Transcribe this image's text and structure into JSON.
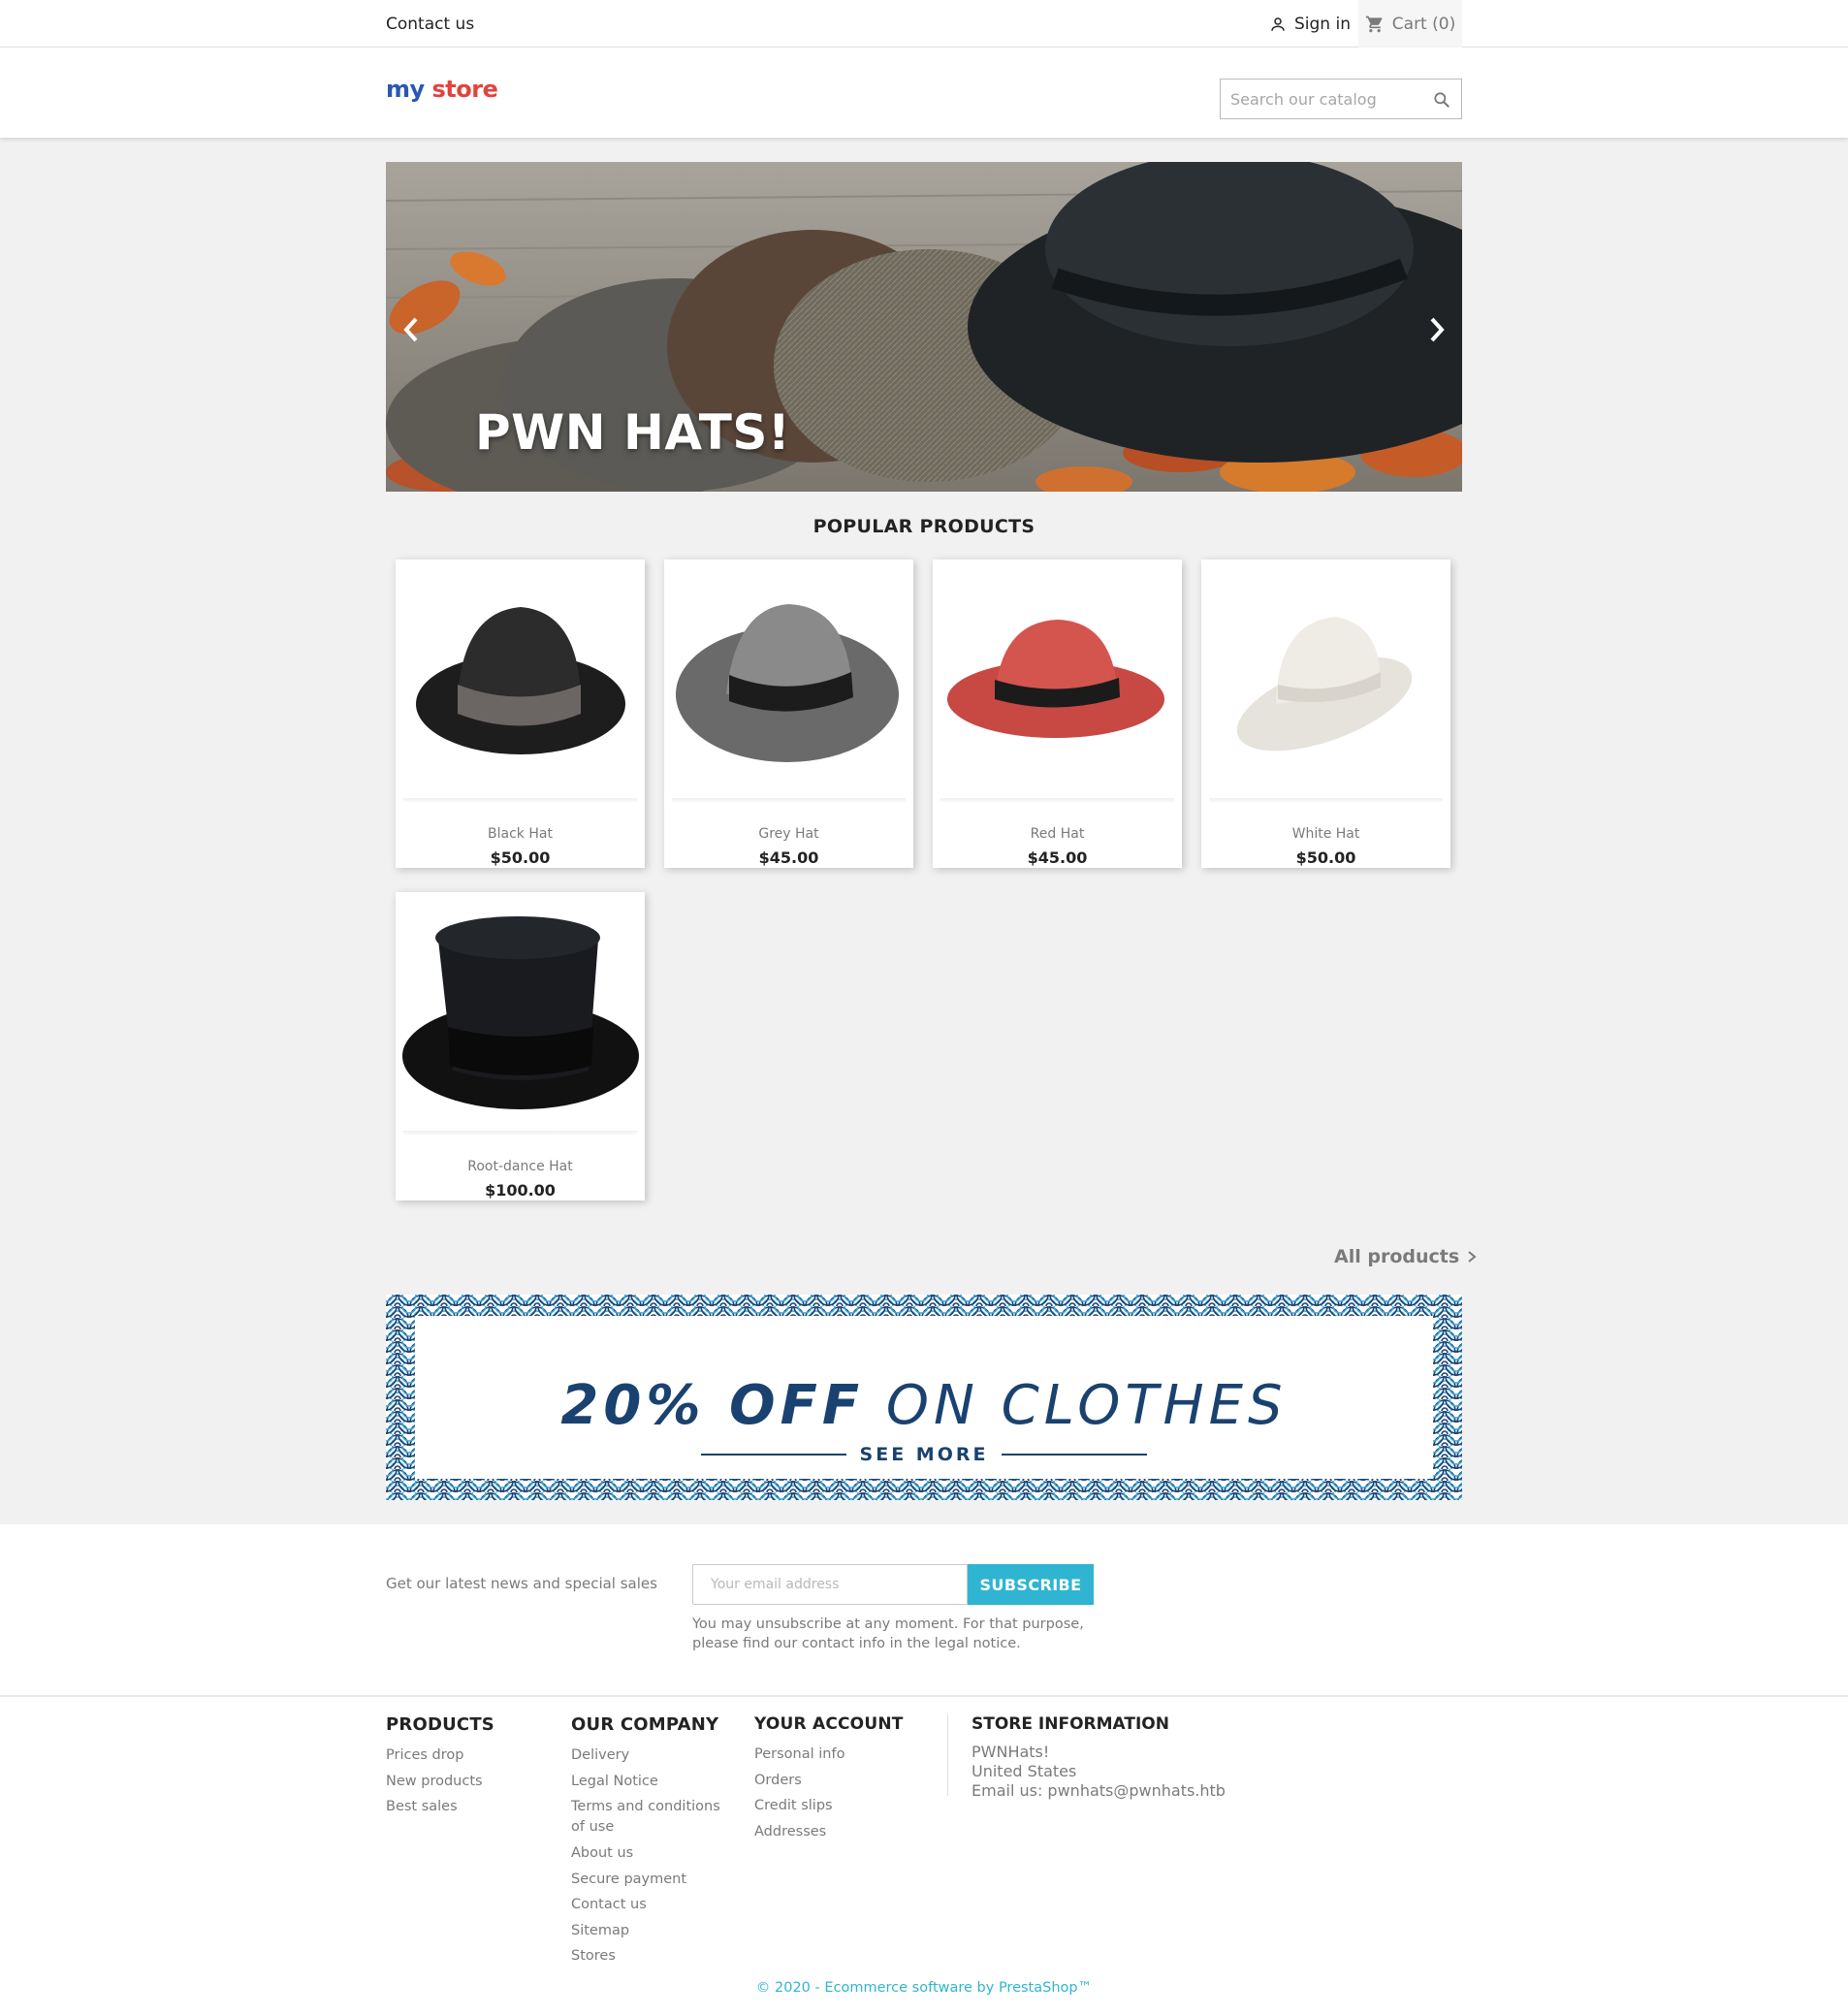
{
  "nav": {
    "contact": "Contact us",
    "signin": "Sign in",
    "cart": "Cart (0)"
  },
  "header": {
    "logo_word1": "my",
    "logo_word2": "store",
    "search_placeholder": "Search our catalog"
  },
  "hero": {
    "caption": "PWN HATS!"
  },
  "popular": {
    "title": "POPULAR PRODUCTS",
    "products": [
      {
        "name": "Black Hat",
        "price": "$50.00"
      },
      {
        "name": "Grey Hat",
        "price": "$45.00"
      },
      {
        "name": "Red Hat",
        "price": "$45.00"
      },
      {
        "name": "White Hat",
        "price": "$50.00"
      },
      {
        "name": "Root-dance Hat",
        "price": "$100.00"
      }
    ],
    "all_products": "All products"
  },
  "banner": {
    "bold": "20% OFF",
    "rest": "ON CLOTHES",
    "cta": "SEE MORE"
  },
  "newsletter": {
    "text": "Get our latest news and special sales",
    "placeholder": "Your email address",
    "button": "SUBSCRIBE",
    "note": "You may unsubscribe at any moment. For that purpose, please find our contact info in the legal notice."
  },
  "footer": {
    "products": {
      "title": "PRODUCTS",
      "links": [
        "Prices drop",
        "New products",
        "Best sales"
      ]
    },
    "company": {
      "title": "OUR COMPANY",
      "links": [
        "Delivery",
        "Legal Notice",
        "Terms and conditions of use",
        "About us",
        "Secure payment",
        "Contact us",
        "Sitemap",
        "Stores"
      ]
    },
    "account": {
      "title": "YOUR ACCOUNT",
      "links": [
        "Personal info",
        "Orders",
        "Credit slips",
        "Addresses"
      ]
    },
    "store": {
      "title": "STORE INFORMATION",
      "name": "PWNHats!",
      "country": "United States",
      "email": "Email us: pwnhats@pwnhats.htb"
    },
    "copyright": "© 2020 - Ecommerce software by PrestaShop™"
  },
  "colors": {
    "accent": "#2fb5d2",
    "banner_blue": "#1a4270",
    "page_grey": "#f1f1f1"
  }
}
